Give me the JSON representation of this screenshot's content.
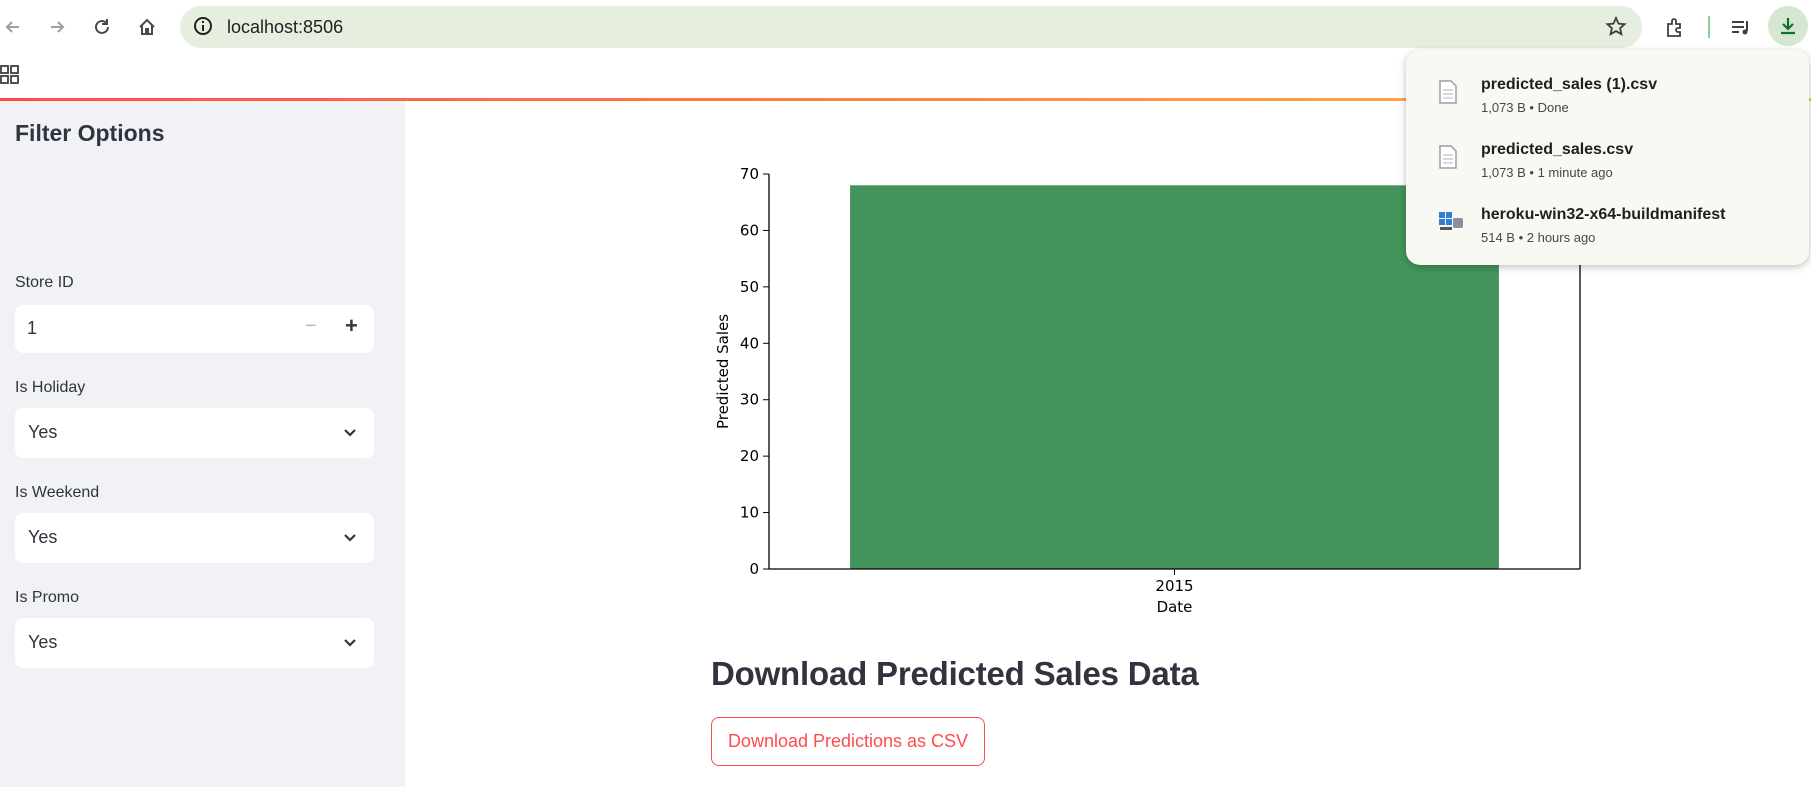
{
  "browser": {
    "url": "localhost:8506",
    "downloads": [
      {
        "name": "predicted_sales (1).csv",
        "meta": "1,073 B • Done",
        "icon": "document-icon"
      },
      {
        "name": "predicted_sales.csv",
        "meta": "1,073 B • 1 minute ago",
        "icon": "document-icon"
      },
      {
        "name": "heroku-win32-x64-buildmanifest",
        "meta": "514 B • 2 hours ago",
        "icon": "windows-installer-icon"
      }
    ]
  },
  "sidebar": {
    "title": "Filter Options",
    "store_id": {
      "label": "Store ID",
      "value": "1",
      "minus": "−",
      "plus": "+"
    },
    "is_holiday": {
      "label": "Is Holiday",
      "value": "Yes"
    },
    "is_weekend": {
      "label": "Is Weekend",
      "value": "Yes"
    },
    "is_promo": {
      "label": "Is Promo",
      "value": "Yes"
    }
  },
  "main": {
    "download_heading": "Download Predicted Sales Data",
    "download_button": "Download Predictions as CSV"
  },
  "chart_data": {
    "type": "bar",
    "categories": [
      "2015"
    ],
    "values": [
      68
    ],
    "xlabel": "Date",
    "ylabel": "Predicted Sales",
    "ylim": [
      0,
      70
    ],
    "yticks": [
      0,
      10,
      20,
      30,
      40,
      50,
      60,
      70
    ],
    "bar_color": "#43945b",
    "grid": false
  },
  "colors": {
    "accent": "#ff4b4b",
    "sidebar_bg": "#f0f2f6",
    "download_button_bg": "#d5e6d1"
  }
}
